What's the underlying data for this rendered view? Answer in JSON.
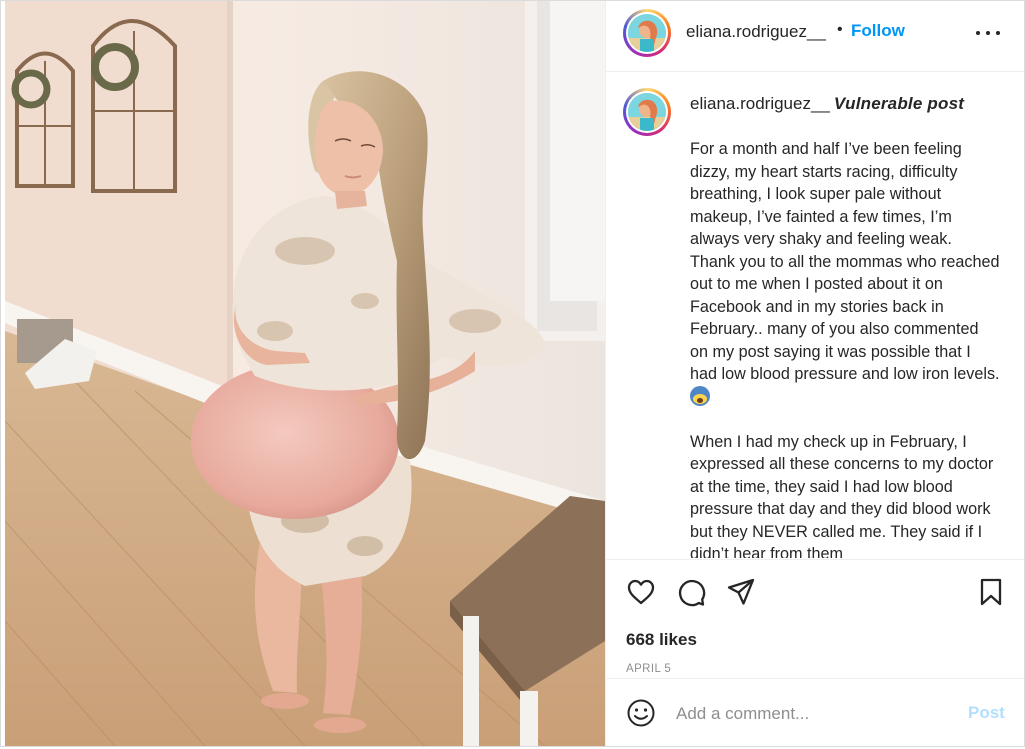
{
  "post": {
    "username": "eliana.rodriguez__",
    "follow_label": "Follow",
    "dot": "•",
    "caption": {
      "username": "eliana.rodriguez__",
      "headline": "Vulnerable post",
      "paragraph1": "For a month and half I’ve been feeling dizzy, my heart starts racing, difficulty breathing, I look super pale without makeup, I’ve fainted a few times, I’m always very shaky and feeling weak. Thank you to all the mommas who reached out to me when I posted about it on Facebook and in my stories back in February.. many of you also commented on my post saying it was possible that I had low blood pressure and low iron levels.",
      "paragraph2": "When I had my check up in February, I expressed all these concerns to my doctor at the time, they said I had low blood pressure that day and they did blood work but they NEVER called me. They said if I didn’t hear from them"
    },
    "likes": "668 likes",
    "date": "APRIL 5"
  },
  "comment": {
    "placeholder": "Add a comment...",
    "post_label": "Post"
  },
  "icons": {
    "heart": "heart-icon",
    "comment": "comment-icon",
    "share": "paper-plane-icon",
    "save": "bookmark-icon",
    "emoji": "smiley-icon",
    "more": "more-options-icon"
  },
  "colors": {
    "follow_blue": "#0095f6",
    "post_disabled": "#b2dffc",
    "muted": "#8e8e8e",
    "border": "#efefef"
  }
}
